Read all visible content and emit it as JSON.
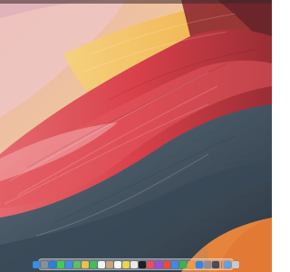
{
  "desktop": {
    "wallpaper_name": "abstract-brushstroke-wallpaper",
    "colors": {
      "sky_pink": "#e9b4b4",
      "peach": "#efc79a",
      "yellow": "#f0b43a",
      "orange": "#e5813a",
      "red": "#d9434a",
      "deep_red": "#8e2a34",
      "slate": "#4f6272",
      "dark_slate": "#2a3440"
    }
  },
  "dock": {
    "apps": [
      {
        "name": "finder-icon",
        "color": "#3b8de0"
      },
      {
        "name": "launchpad-icon",
        "color": "#8a8f99"
      },
      {
        "name": "safari-icon",
        "color": "#2a7fd8"
      },
      {
        "name": "messages-icon",
        "color": "#3ccf52"
      },
      {
        "name": "mail-icon",
        "color": "#3d8fe6"
      },
      {
        "name": "maps-icon",
        "color": "#5bbf63"
      },
      {
        "name": "photos-icon",
        "color": "#e9c04a"
      },
      {
        "name": "facetime-icon",
        "color": "#38c35a"
      },
      {
        "name": "calendar-icon",
        "color": "#f3f3f3"
      },
      {
        "name": "contacts-icon",
        "color": "#c9a27a"
      },
      {
        "name": "reminders-icon",
        "color": "#f6f6f6"
      },
      {
        "name": "notes-icon",
        "color": "#f3d24b"
      },
      {
        "name": "freeform-icon",
        "color": "#e8e8ee"
      },
      {
        "name": "tv-icon",
        "color": "#1d1d22"
      },
      {
        "name": "music-icon",
        "color": "#f04a5e"
      },
      {
        "name": "podcasts-icon",
        "color": "#9b4de0"
      },
      {
        "name": "news-icon",
        "color": "#f0473f"
      },
      {
        "name": "keynote-icon",
        "color": "#3a8ce8"
      },
      {
        "name": "numbers-icon",
        "color": "#3fb24e"
      },
      {
        "name": "pages-icon",
        "color": "#f19c3a"
      },
      {
        "name": "app-store-icon",
        "color": "#2f86f0"
      },
      {
        "name": "system-settings-icon",
        "color": "#8c8f96"
      },
      {
        "name": "iphone-mirroring-icon",
        "color": "#4a4d57"
      }
    ],
    "extras": [
      {
        "name": "downloads-folder-icon",
        "color": "#5aa2e6"
      },
      {
        "name": "trash-icon",
        "color": "#c7cad0"
      }
    ]
  }
}
